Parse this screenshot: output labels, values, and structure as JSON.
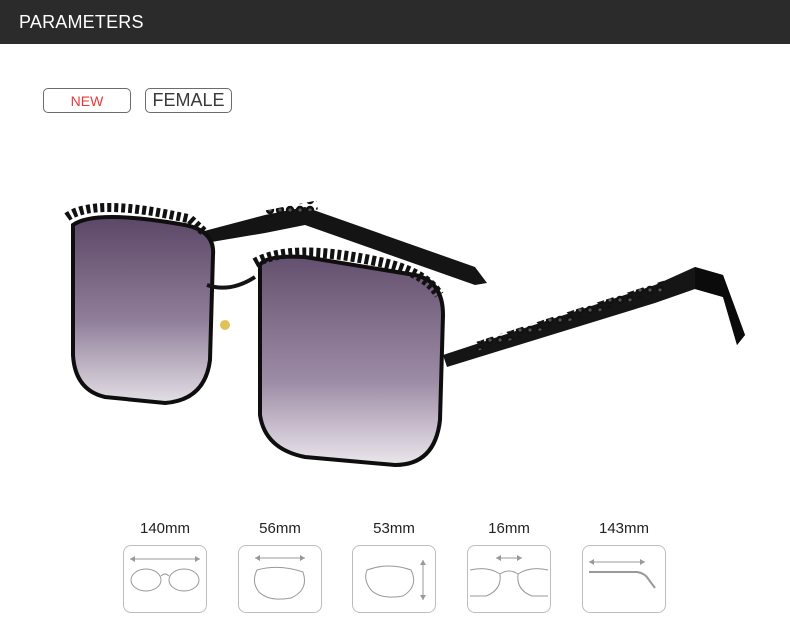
{
  "header": {
    "title": "PARAMETERS"
  },
  "tags": {
    "new": {
      "label": "NEW",
      "color": "#e53935"
    },
    "gender": {
      "label": "FEMALE"
    }
  },
  "product": {
    "image": "sunglasses-icon"
  },
  "measurements": [
    {
      "value": "140mm",
      "icon": "frame-width-icon"
    },
    {
      "value": "56mm",
      "icon": "lens-width-icon"
    },
    {
      "value": "53mm",
      "icon": "lens-height-icon"
    },
    {
      "value": "16mm",
      "icon": "bridge-width-icon"
    },
    {
      "value": "143mm",
      "icon": "temple-length-icon"
    }
  ]
}
